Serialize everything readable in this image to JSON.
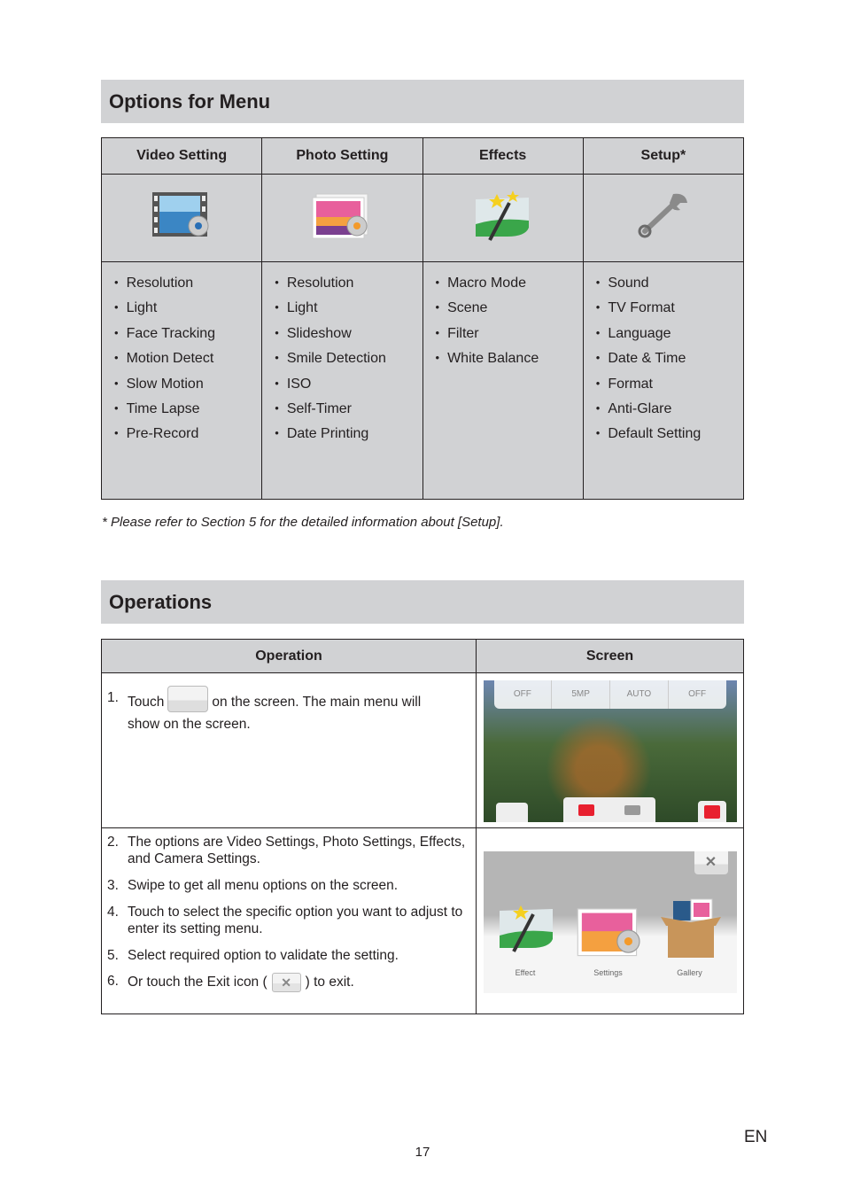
{
  "menu_section": {
    "title": "Options for Menu",
    "columns": [
      {
        "header": "Video Setting",
        "icon": "video-settings-icon",
        "items": [
          "Resolution",
          "Light",
          "Face Tracking",
          "Motion Detect",
          "Slow Motion",
          "Time Lapse",
          "Pre-Record"
        ]
      },
      {
        "header": "Photo Setting",
        "icon": "photo-settings-icon",
        "items": [
          "Resolution",
          "Light",
          "Slideshow",
          "Smile Detection",
          "ISO",
          "Self-Timer",
          "Date Printing"
        ]
      },
      {
        "header": "Effects",
        "icon": "effects-icon",
        "items": [
          "Macro Mode",
          "Scene",
          "Filter",
          "White Balance"
        ]
      },
      {
        "header": "Setup*",
        "icon": "wrench-icon",
        "items": [
          "Sound",
          "TV Format",
          "Language",
          "Date & Time",
          "Format",
          "Anti-Glare",
          "Default Setting"
        ]
      }
    ],
    "footnote": "* Please refer to Section 5 for the detailed information about [Setup]."
  },
  "operations_section": {
    "title": "Operations",
    "headers": {
      "operation": "Operation",
      "screen": "Screen"
    },
    "step1": {
      "num": "1.",
      "before": "Touch",
      "after": "on the screen. The main menu will",
      "line2": "show on the screen."
    },
    "steps": [
      {
        "num": "2.",
        "text": "The options are Video Settings, Photo Settings, Effects, and Camera Settings."
      },
      {
        "num": "3.",
        "text": "Swipe to get all menu options on the screen."
      },
      {
        "num": "4.",
        "text": "Touch to select the specific option you want to adjust to enter its setting menu."
      },
      {
        "num": "5.",
        "text": "Select required option to validate the setting."
      }
    ],
    "step6": {
      "num": "6.",
      "before": "Or touch the Exit icon (",
      "after": ") to exit."
    },
    "screen1": {
      "top_bar": [
        "OFF",
        "5MP",
        "AUTO",
        "OFF"
      ]
    },
    "screen2": {
      "labels": [
        "Effect",
        "Settings",
        "Gallery"
      ],
      "close": "✕"
    }
  },
  "footer": {
    "page": "17",
    "lang": "EN"
  }
}
